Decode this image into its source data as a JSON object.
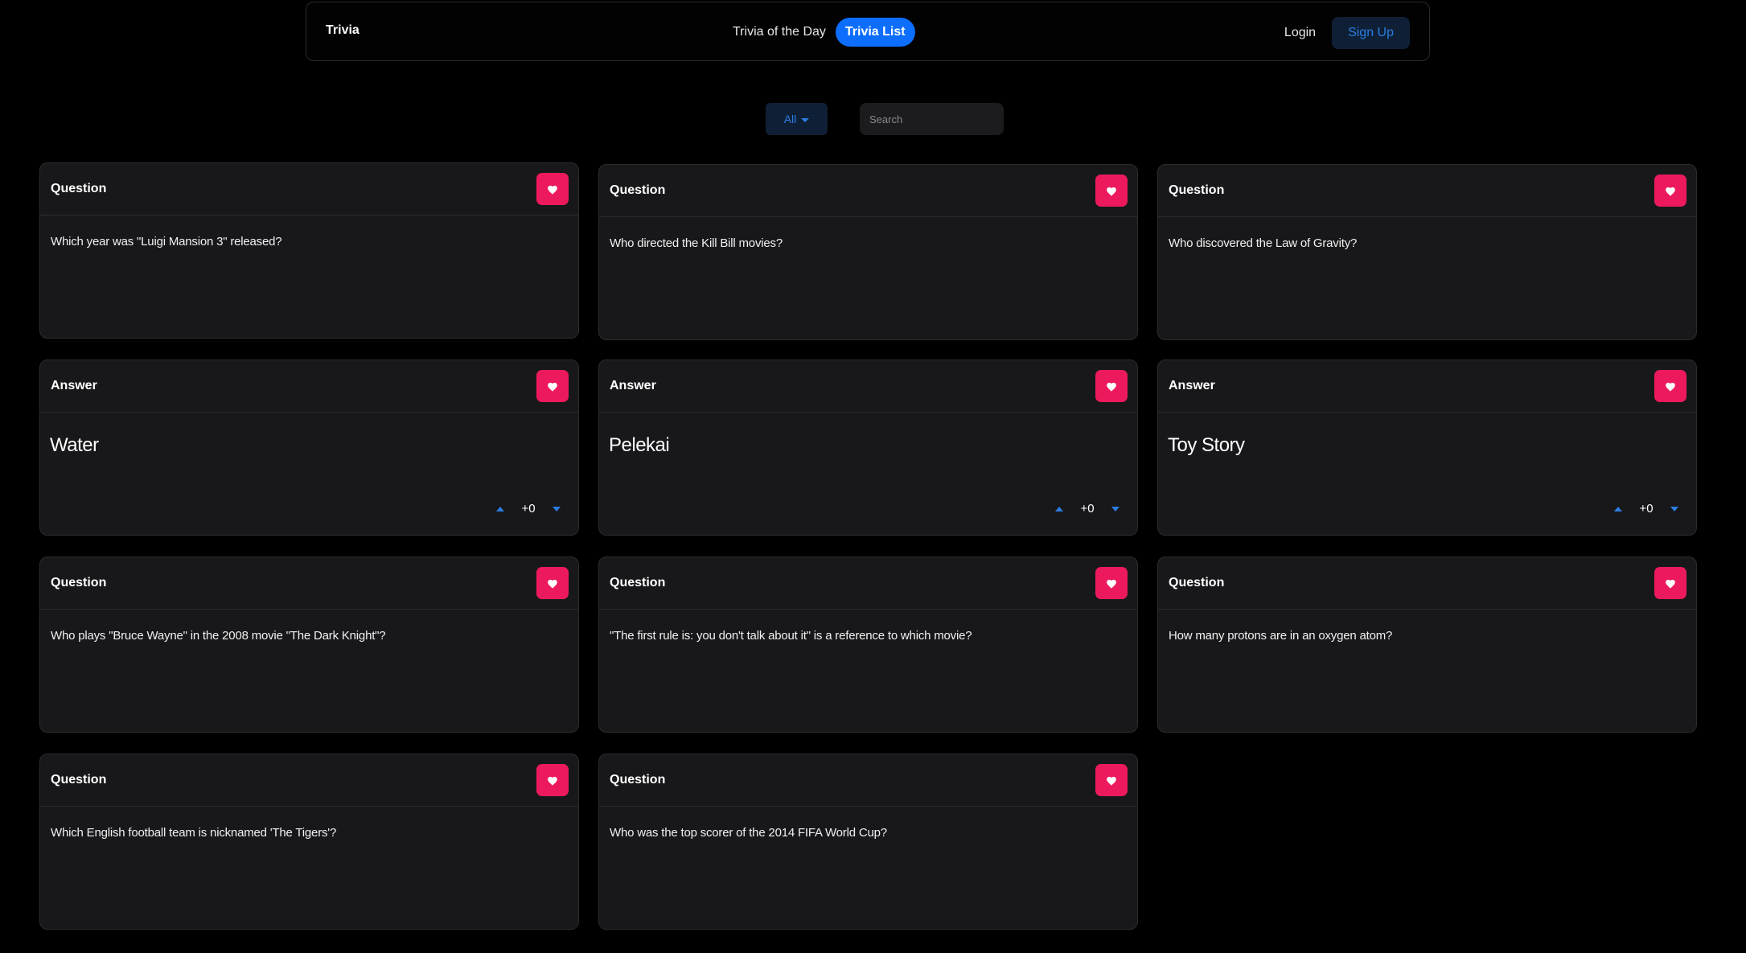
{
  "nav": {
    "brand": "Trivia",
    "links": [
      "Trivia of the Day",
      "Trivia List"
    ],
    "active_link": "Trivia List",
    "login_label": "Login",
    "signup_label": "Sign Up"
  },
  "filters": {
    "category_label": "All",
    "search_placeholder": "Search"
  },
  "colors": {
    "accent": "#0d6efd",
    "heart": "#ec1a5c",
    "card_bg": "#18181b",
    "page_bg": "#000000"
  },
  "cards": [
    {
      "type": "Question",
      "text": "Which year was \"Luigi Mansion 3\" released?"
    },
    {
      "type": "Question",
      "text": "Who directed the Kill Bill movies?"
    },
    {
      "type": "Question",
      "text": "Who discovered the Law of Gravity?"
    },
    {
      "type": "Answer",
      "text": "Water",
      "votes": "+0"
    },
    {
      "type": "Answer",
      "text": "Pelekai",
      "votes": "+0"
    },
    {
      "type": "Answer",
      "text": "Toy Story",
      "votes": "+0"
    },
    {
      "type": "Question",
      "text": "Who plays \"Bruce Wayne\" in the 2008 movie \"The Dark Knight\"?"
    },
    {
      "type": "Question",
      "text": "\"The first rule is: you don't talk about it\" is a reference to which movie?"
    },
    {
      "type": "Question",
      "text": "How many protons are in an oxygen atom?"
    },
    {
      "type": "Question",
      "text": "Which English football team is nicknamed 'The Tigers'?"
    },
    {
      "type": "Question",
      "text": "Who was the top scorer of the 2014 FIFA World Cup?"
    }
  ]
}
